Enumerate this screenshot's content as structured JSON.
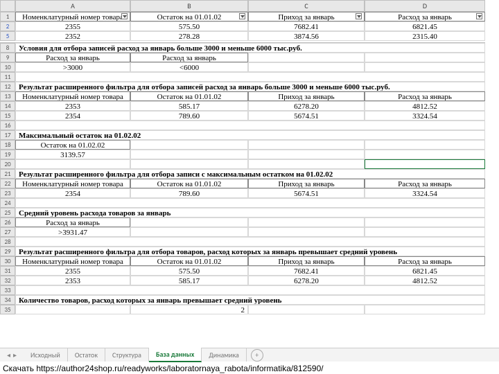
{
  "columns": [
    "A",
    "B",
    "C",
    "D"
  ],
  "headers": {
    "num": "Номенклатурный номер товара",
    "ost": "Остаток на 01.01.02",
    "prih": "Приход за январь",
    "rash": "Расход за январь"
  },
  "top": [
    {
      "r": "2",
      "a": "2355",
      "b": "575.50",
      "c": "7682.41",
      "d": "6821.45"
    },
    {
      "r": "5",
      "a": "2352",
      "b": "278.28",
      "c": "3874.56",
      "d": "2315.40"
    }
  ],
  "sec8": "Условия для отбора записей расход за январь больше 3000 и меньше 6000 тыс.руб.",
  "crit": {
    "h1": "Расход за январь",
    "h2": "Расход за январь",
    "v1": ">3000",
    "v2": "<6000"
  },
  "sec12": "Результат расширенного фильтра для отбора записей расход за январь больше 3000 и меньше 6000 тыс.руб.",
  "res1": [
    {
      "r": "14",
      "a": "2353",
      "b": "585.17",
      "c": "6278.20",
      "d": "4812.52"
    },
    {
      "r": "15",
      "a": "2354",
      "b": "789.60",
      "c": "5674.51",
      "d": "3324.54"
    }
  ],
  "sec17": "Максимальный остаток на 01.02.02",
  "max": {
    "h": "Остаток на 01.02.02",
    "v": "3139.57"
  },
  "sec21": "Результат расширенного фильтра для отбора записи с максимальным остатком на 01.02.02",
  "res2": [
    {
      "r": "23",
      "a": "2354",
      "b": "789.60",
      "c": "5674.51",
      "d": "3324.54"
    }
  ],
  "sec25": "Средний уровень расхода товаров за январь",
  "avg": {
    "h": "Расход за январь",
    "v": ">3931.47"
  },
  "sec29": "Результат расширенного фильтра для отбора товаров, расход которых за январь превышает средний уровень",
  "res3": [
    {
      "r": "31",
      "a": "2355",
      "b": "575.50",
      "c": "7682.41",
      "d": "6821.45"
    },
    {
      "r": "32",
      "a": "2353",
      "b": "585.17",
      "c": "6278.20",
      "d": "4812.52"
    }
  ],
  "sec34": "Количество товаров, расход которых за январь превышает средний уровень",
  "r35b": "2",
  "tabs": [
    "Исходный",
    "Остаток",
    "Структура",
    "База данных",
    "Динамика"
  ],
  "footer": "Скачать https://author24shop.ru/readyworks/laboratornaya_rabota/informatika/812590/"
}
